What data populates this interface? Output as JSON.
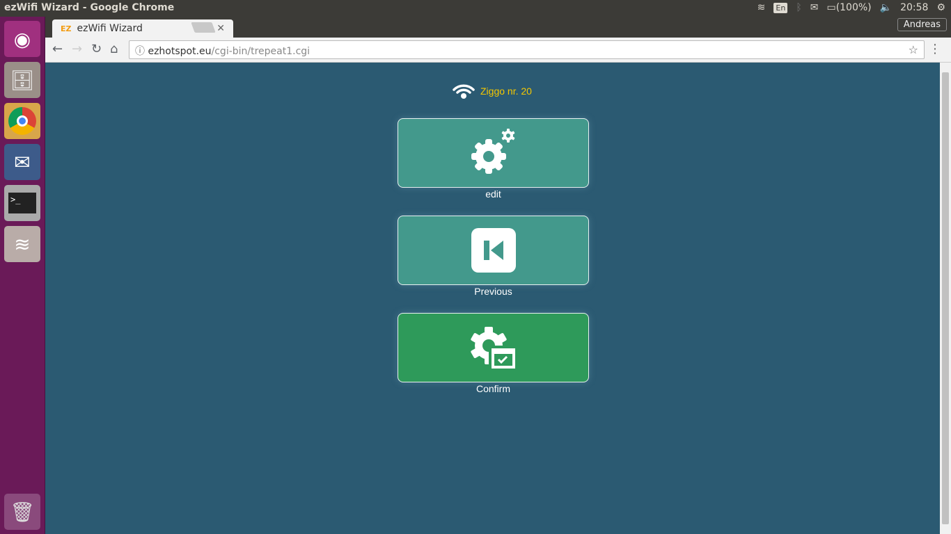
{
  "window": {
    "title": "ezWifi Wizard - Google Chrome"
  },
  "tray": {
    "keyboard": "En",
    "battery": "(100%)",
    "time": "20:58",
    "user": "Andreas"
  },
  "browser": {
    "tab_title": "ezWifi Wizard",
    "url_host": "ezhotspot.eu",
    "url_path": "/cgi-bin/trepeat1.cgi"
  },
  "page": {
    "network_name": "Ziggo nr. 20",
    "buttons": [
      {
        "label": "edit",
        "color": "#43998c"
      },
      {
        "label": "Previous",
        "color": "#43998c"
      },
      {
        "label": "Confirm",
        "color": "#2e9a5a"
      }
    ]
  }
}
